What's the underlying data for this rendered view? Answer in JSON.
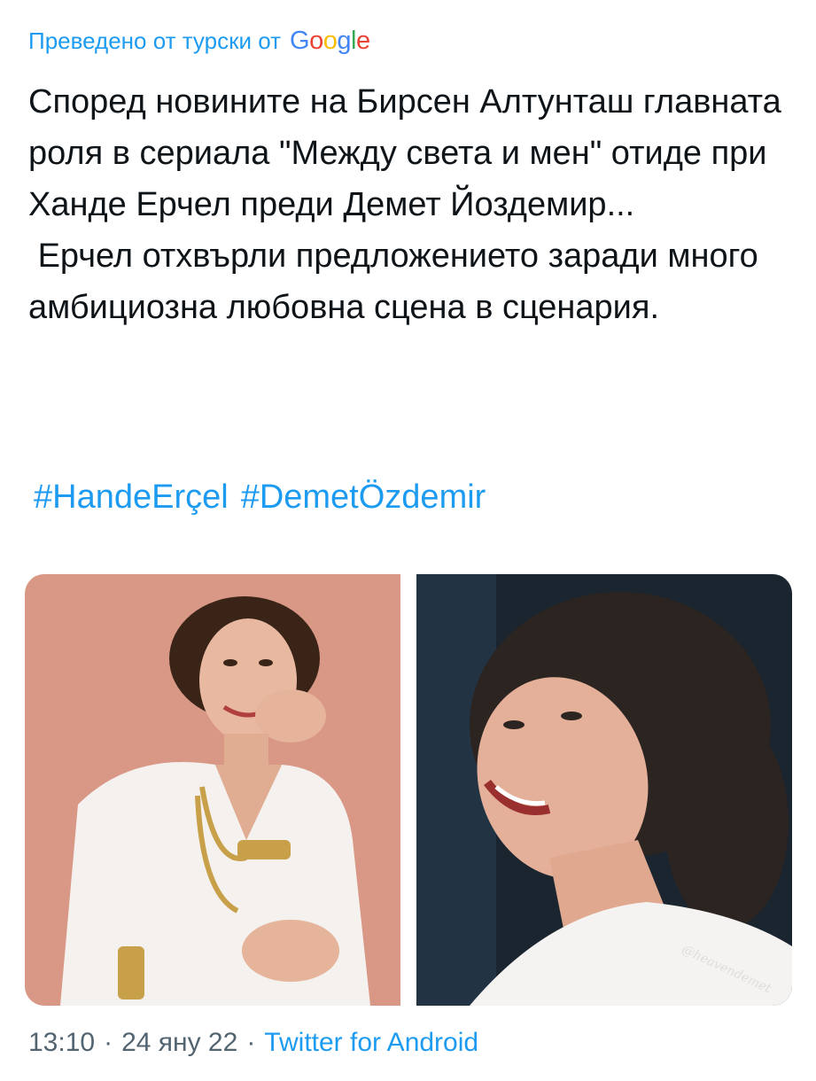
{
  "translation": {
    "label": "Преведено от турски от",
    "provider_letters": [
      "G",
      "o",
      "o",
      "g",
      "l",
      "e"
    ]
  },
  "tweet": {
    "text": "Според новините на Бирсен Алтунташ главната роля в сериала \"Между света и мен\" отиде при Ханде Ерчел преди Демет Йоздемир...\n Ерчел отхвърли предложението заради много амбициозна любовна сцена в сценария.",
    "hashtags": [
      "#HandeErçel",
      "#DemetÖzdemir"
    ]
  },
  "media": {
    "photo_1": {
      "subject": "woman-smiling-white-shirt-gold-jewelry",
      "background_color": "#d99886"
    },
    "photo_2": {
      "subject": "woman-smiling-curly-hair-dark-background",
      "background_color": "#1a2530",
      "watermark": "@heavendemet"
    }
  },
  "meta": {
    "time": "13:10",
    "separator": "·",
    "date": "24 яну 22",
    "source": "Twitter for Android"
  },
  "colors": {
    "link": "#1d9bf0",
    "text": "#0f1419",
    "secondary": "#536471"
  }
}
